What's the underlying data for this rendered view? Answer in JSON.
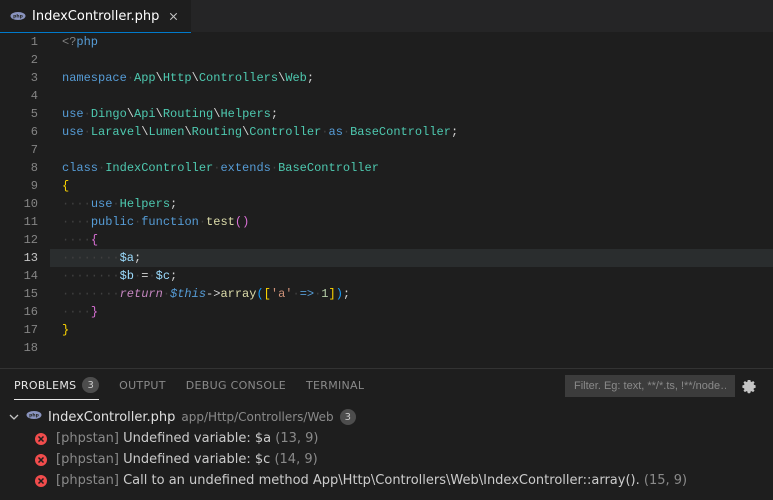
{
  "tab": {
    "title": "IndexController.php"
  },
  "editor": {
    "lineNumbers": [
      "1",
      "2",
      "3",
      "4",
      "5",
      "6",
      "7",
      "8",
      "9",
      "10",
      "11",
      "12",
      "13",
      "14",
      "15",
      "16",
      "17",
      "18"
    ],
    "currentLine": 13
  },
  "code": {
    "l1": {
      "tag1": "<?",
      "tag2": "php"
    },
    "l3": {
      "kw": "namespace",
      "p1": "App",
      "p2": "Http",
      "p3": "Controllers",
      "p4": "Web"
    },
    "l5": {
      "kw": "use",
      "p1": "Dingo",
      "p2": "Api",
      "p3": "Routing",
      "p4": "Helpers"
    },
    "l6": {
      "kw": "use",
      "p1": "Laravel",
      "p2": "Lumen",
      "p3": "Routing",
      "p4": "Controller",
      "as": "as",
      "alias": "BaseController"
    },
    "l8": {
      "kw1": "class",
      "name": "IndexController",
      "kw2": "extends",
      "base": "BaseController"
    },
    "l9": {
      "b": "{"
    },
    "l10": {
      "kw": "use",
      "trait": "Helpers"
    },
    "l11": {
      "kw1": "public",
      "kw2": "function",
      "fn": "test"
    },
    "l12": {
      "b": "{"
    },
    "l13": {
      "var": "$a"
    },
    "l14": {
      "var1": "$b",
      "var2": "$c"
    },
    "l15": {
      "ret": "return",
      "this": "$this",
      "fn": "array",
      "key": "'a'",
      "arrow": "=>",
      "val": "1"
    },
    "l16": {
      "b": "}"
    },
    "l17": {
      "b": "}"
    }
  },
  "panel": {
    "tabs": {
      "problems": "PROBLEMS",
      "output": "OUTPUT",
      "debug": "DEBUG CONSOLE",
      "terminal": "TERMINAL"
    },
    "problemsCount": "3",
    "filterPlaceholder": "Filter. Eg: text, **/*.ts, !**/node…"
  },
  "problems": {
    "file": "IndexController.php",
    "path": "app/Http/Controllers/Web",
    "count": "3",
    "items": [
      {
        "src": "[phpstan]",
        "msg": "Undefined variable: $a",
        "loc": "(13, 9)"
      },
      {
        "src": "[phpstan]",
        "msg": "Undefined variable: $c",
        "loc": "(14, 9)"
      },
      {
        "src": "[phpstan]",
        "msg": "Call to an undefined method App\\Http\\Controllers\\Web\\IndexController::array().",
        "loc": "(15, 9)"
      }
    ]
  }
}
